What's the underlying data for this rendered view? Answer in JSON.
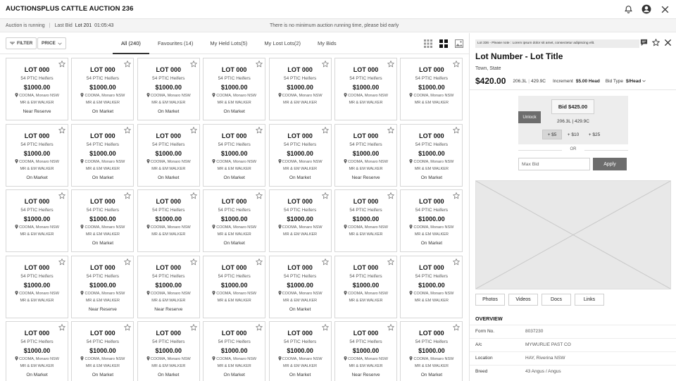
{
  "header": {
    "title": "AUCTIONSPLUS CATTLE AUCTION 236",
    "icons": [
      "bell-icon",
      "user-icon",
      "close-icon"
    ]
  },
  "status": {
    "running": "Auction is running",
    "last_bid_label": "Last Bid",
    "last_lot": "Lot 201",
    "last_time": "01:05:43",
    "message": "There is no minimum auction running time, please bid early"
  },
  "toolbar": {
    "filter_label": "FILTER",
    "price_label": "PRICE",
    "tabs": [
      {
        "label": "All (240)"
      },
      {
        "label": "Favourites (14)"
      },
      {
        "label": "My Held Lots(5)"
      },
      {
        "label": "My Lost Lots(2)"
      },
      {
        "label": "My Bids"
      }
    ]
  },
  "lots": [
    {
      "lot": "LOT 000",
      "desc": "54 PTIC Heifers",
      "price": "$1000.00",
      "location": "COOMA, Monaro NSW",
      "vendor": "MR & EM WALKER",
      "status": "Near Reserve"
    },
    {
      "lot": "LOT 000",
      "desc": "54 PTIC Heifers",
      "price": "$1000.00",
      "location": "COOMA, Monaro NSW",
      "vendor": "MR & EM WALKER",
      "status": "On Market"
    },
    {
      "lot": "LOT 000",
      "desc": "54 PTIC Heifers",
      "price": "$1000.00",
      "location": "COOMA, Monaro NSW",
      "vendor": "MR & EM WALKER",
      "status": "On Market"
    },
    {
      "lot": "LOT 000",
      "desc": "54 PTIC Heifers",
      "price": "$1000.00",
      "location": "COOMA, Monaro NSW",
      "vendor": "MR & EM WALKER",
      "status": "On Market"
    },
    {
      "lot": "LOT 000",
      "desc": "54 PTIC Heifers",
      "price": "$1000.00",
      "location": "COOMA, Monaro NSW",
      "vendor": "MR & EM WALKER",
      "status": ""
    },
    {
      "lot": "LOT 000",
      "desc": "54 PTIC Heifers",
      "price": "$1000.00",
      "location": "COOMA, Monaro NSW",
      "vendor": "MR & EM WALKER",
      "status": ""
    },
    {
      "lot": "LOT 000",
      "desc": "54 PTIC Heifers",
      "price": "$1000.00",
      "location": "COOMA, Monaro NSW",
      "vendor": "MR & EM WALKER",
      "status": ""
    },
    {
      "lot": "LOT 000",
      "desc": "54 PTIC Heifers",
      "price": "$1000.00",
      "location": "COOMA, Monaro NSW",
      "vendor": "MR & EM WALKER",
      "status": "On Market"
    },
    {
      "lot": "LOT 000",
      "desc": "54 PTIC Heifers",
      "price": "$1000.00",
      "location": "COOMA, Monaro NSW",
      "vendor": "MR & EM WALKER",
      "status": "On Market"
    },
    {
      "lot": "LOT 000",
      "desc": "54 PTIC Heifers",
      "price": "$1000.00",
      "location": "COOMA, Monaro NSW",
      "vendor": "MR & EM WALKER",
      "status": "On Market"
    },
    {
      "lot": "LOT 000",
      "desc": "54 PTIC Heifers",
      "price": "$1000.00",
      "location": "COOMA, Monaro NSW",
      "vendor": "MR & EM WALKER",
      "status": "On Market"
    },
    {
      "lot": "LOT 000",
      "desc": "54 PTIC Heifers",
      "price": "$1000.00",
      "location": "COOMA, Monaro NSW",
      "vendor": "MR & EM WALKER",
      "status": "On Market"
    },
    {
      "lot": "LOT 000",
      "desc": "54 PTIC Heifers",
      "price": "$1000.00",
      "location": "COOMA, Monaro NSW",
      "vendor": "MR & EM WALKER",
      "status": "Near Reserve"
    },
    {
      "lot": "LOT 000",
      "desc": "54 PTIC Heifers",
      "price": "$1000.00",
      "location": "COOMA, Monaro NSW",
      "vendor": "MR & EM WALKER",
      "status": "On Market"
    },
    {
      "lot": "LOT 000",
      "desc": "54 PTIC Heifers",
      "price": "$1000.00",
      "location": "COOMA, Monaro NSW",
      "vendor": "MR & EM WALKER",
      "status": ""
    },
    {
      "lot": "LOT 000",
      "desc": "54 PTIC Heifers",
      "price": "$1000.00",
      "location": "COOMA, Monaro NSW",
      "vendor": "MR & EM WALKER",
      "status": "On Market"
    },
    {
      "lot": "LOT 000",
      "desc": "54 PTIC Heifers",
      "price": "$1000.00",
      "location": "COOMA, Monaro NSW",
      "vendor": "MR & EM WALKER",
      "status": ""
    },
    {
      "lot": "LOT 000",
      "desc": "54 PTIC Heifers",
      "price": "$1000.00",
      "location": "COOMA, Monaro NSW",
      "vendor": "MR & EM WALKER",
      "status": "On Market"
    },
    {
      "lot": "LOT 000",
      "desc": "54 PTIC Heifers",
      "price": "$1000.00",
      "location": "COOMA, Monaro NSW",
      "vendor": "MR & EM WALKER",
      "status": ""
    },
    {
      "lot": "LOT 000",
      "desc": "54 PTIC Heifers",
      "price": "$1000.00",
      "location": "COOMA, Monaro NSW",
      "vendor": "MR & EM WALKER",
      "status": ""
    },
    {
      "lot": "LOT 000",
      "desc": "54 PTIC Heifers",
      "price": "$1000.00",
      "location": "COOMA, Monaro NSW",
      "vendor": "MR & EM WALKER",
      "status": "On Market"
    },
    {
      "lot": "LOT 000",
      "desc": "54 PTIC Heifers",
      "price": "$1000.00",
      "location": "COOMA, Monaro NSW",
      "vendor": "MR & EM WALKER",
      "status": ""
    },
    {
      "lot": "LOT 000",
      "desc": "54 PTIC Heifers",
      "price": "$1000.00",
      "location": "COOMA, Monaro NSW",
      "vendor": "MR & EM WALKER",
      "status": "Near Reserve"
    },
    {
      "lot": "LOT 000",
      "desc": "54 PTIC Heifers",
      "price": "$1000.00",
      "location": "COOMA, Monaro NSW",
      "vendor": "MR & EM WALKER",
      "status": "Near Reserve"
    },
    {
      "lot": "LOT 000",
      "desc": "54 PTIC Heifers",
      "price": "$1000.00",
      "location": "COOMA, Monaro NSW",
      "vendor": "MR & EM WALKER",
      "status": ""
    },
    {
      "lot": "LOT 000",
      "desc": "54 PTIC Heifers",
      "price": "$1000.00",
      "location": "COOMA, Monaro NSW",
      "vendor": "MR & EM WALKER",
      "status": "On Market"
    },
    {
      "lot": "LOT 000",
      "desc": "54 PTIC Heifers",
      "price": "$1000.00",
      "location": "COOMA, Monaro NSW",
      "vendor": "MR & EM WALKER",
      "status": ""
    },
    {
      "lot": "LOT 000",
      "desc": "54 PTIC Heifers",
      "price": "$1000.00",
      "location": "COOMA, Monaro NSW",
      "vendor": "MR & EM WALKER",
      "status": ""
    },
    {
      "lot": "LOT 000",
      "desc": "54 PTIC Heifers",
      "price": "$1000.00",
      "location": "COOMA, Monaro NSW",
      "vendor": "MR & EM WALKER",
      "status": "On Market"
    },
    {
      "lot": "LOT 000",
      "desc": "54 PTIC Heifers",
      "price": "$1000.00",
      "location": "COOMA, Monaro NSW",
      "vendor": "MR & EM WALKER",
      "status": "On Market"
    },
    {
      "lot": "LOT 000",
      "desc": "54 PTIC Heifers",
      "price": "$1000.00",
      "location": "COOMA, Monaro NSW",
      "vendor": "MR & EM WALKER",
      "status": "On Market"
    },
    {
      "lot": "LOT 000",
      "desc": "54 PTIC Heifers",
      "price": "$1000.00",
      "location": "COOMA, Monaro NSW",
      "vendor": "MR & EM WALKER",
      "status": "On Market"
    },
    {
      "lot": "LOT 000",
      "desc": "54 PTIC Heifers",
      "price": "$1000.00",
      "location": "COOMA, Monaro NSW",
      "vendor": "MR & EM WALKER",
      "status": "On Market"
    },
    {
      "lot": "LOT 000",
      "desc": "54 PTIC Heifers",
      "price": "$1000.00",
      "location": "COOMA, Monaro NSW",
      "vendor": "MR & EM WALKER",
      "status": "Near Reserve"
    },
    {
      "lot": "LOT 000",
      "desc": "54 PTIC Heifers",
      "price": "$1000.00",
      "location": "COOMA, Monaro NSW",
      "vendor": "MR & EM WALKER",
      "status": "On Market"
    }
  ],
  "panel": {
    "notice": "Lot 336 - Please note : Lorem ipsum dolor sit amet, consectetur adipiscing elit.",
    "title": "Lot Number - Lot Title",
    "town": "Town, State",
    "price": "$420.00",
    "weight": "206.3L",
    "weight2": "429.9C",
    "increment_label": "Increment",
    "increment_value": "$5.00 Head",
    "bid_type_label": "Bid Type",
    "bid_type_value": "$/Head",
    "unlock_label": "Unlock",
    "bid_label": "Bid $425.00",
    "bid_weight": "206.3L",
    "bid_weight2": "429.9C",
    "steps": [
      "+ $5",
      "+ $10",
      "+ $25"
    ],
    "or_label": "OR",
    "max_bid_placeholder": "Max Bid",
    "apply_label": "Apply",
    "media_tabs": [
      "Photos",
      "Videos",
      "Docs",
      "Links"
    ],
    "overview_title": "OVERVIEW",
    "overview": [
      {
        "key": "Form No.",
        "value": "8037230"
      },
      {
        "key": "A/c",
        "value": "MYWURLIE PAST CO"
      },
      {
        "key": "Location",
        "value": "HAY, Riverina NSW"
      },
      {
        "key": "Breed",
        "value": "43 Angus / Angus"
      }
    ]
  },
  "colors": {
    "dark_button": "#6d6d6d",
    "border": "#d7d7d7",
    "text": "#111111"
  }
}
